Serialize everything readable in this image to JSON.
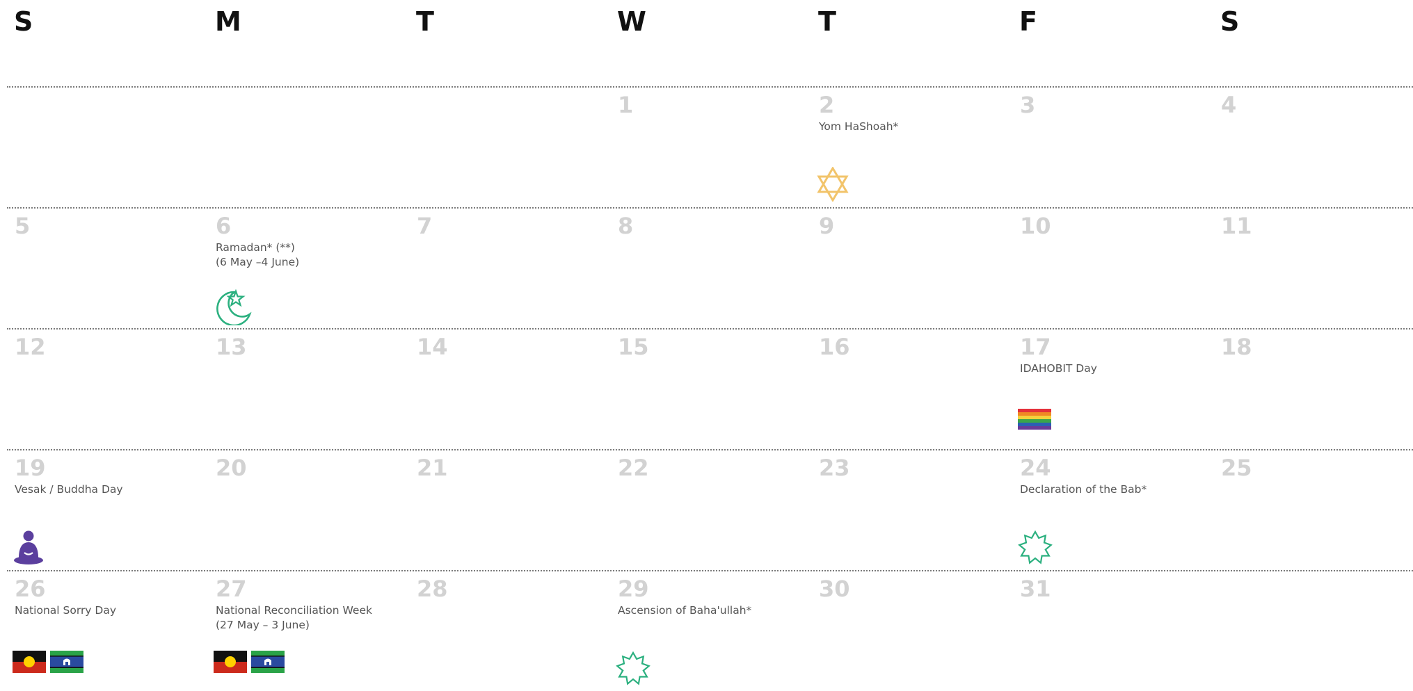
{
  "weekdays": [
    "S",
    "M",
    "T",
    "W",
    "T",
    "F",
    "S"
  ],
  "weeks": [
    [
      null,
      null,
      null,
      {
        "day": "1"
      },
      {
        "day": "2",
        "event": [
          "Yom HaShoah*"
        ],
        "icons": [
          "star-of-david"
        ]
      },
      {
        "day": "3"
      },
      {
        "day": "4"
      }
    ],
    [
      {
        "day": "5"
      },
      {
        "day": "6",
        "event": [
          "Ramadan* (**)",
          "(6 May –4 June)"
        ],
        "icons": [
          "crescent-star"
        ]
      },
      {
        "day": "7"
      },
      {
        "day": "8"
      },
      {
        "day": "9"
      },
      {
        "day": "10"
      },
      {
        "day": "11"
      }
    ],
    [
      {
        "day": "12"
      },
      {
        "day": "13"
      },
      {
        "day": "14"
      },
      {
        "day": "15"
      },
      {
        "day": "16"
      },
      {
        "day": "17",
        "event": [
          "IDAHOBIT Day"
        ],
        "icons": [
          "rainbow-flag"
        ]
      },
      {
        "day": "18"
      }
    ],
    [
      {
        "day": "19",
        "event": [
          "Vesak / Buddha Day"
        ],
        "icons": [
          "buddha"
        ]
      },
      {
        "day": "20"
      },
      {
        "day": "21"
      },
      {
        "day": "22"
      },
      {
        "day": "23"
      },
      {
        "day": "24",
        "event": [
          "Declaration of the Bab*"
        ],
        "icons": [
          "nine-pointed-star"
        ]
      },
      {
        "day": "25"
      }
    ],
    [
      {
        "day": "26",
        "event": [
          "National Sorry Day"
        ],
        "icons": [
          "aboriginal-flag",
          "torres-strait-islander-flag"
        ]
      },
      {
        "day": "27",
        "event": [
          "National Reconciliation Week",
          "(27 May – 3 June)"
        ],
        "icons": [
          "aboriginal-flag",
          "torres-strait-islander-flag"
        ]
      },
      {
        "day": "28"
      },
      {
        "day": "29",
        "event": [
          "Ascension of Baha'ullah*"
        ],
        "icons": [
          "nine-pointed-star"
        ]
      },
      {
        "day": "30"
      },
      {
        "day": "31"
      },
      null
    ]
  ],
  "colors": {
    "day_number": "#d2d2d2",
    "weekday": "#111111",
    "event_text": "#555555",
    "star_of_david": "#f2c46b",
    "crescent": "#2bb07f",
    "bahai_star": "#2bb07f",
    "buddha": "#5b3f9e"
  }
}
